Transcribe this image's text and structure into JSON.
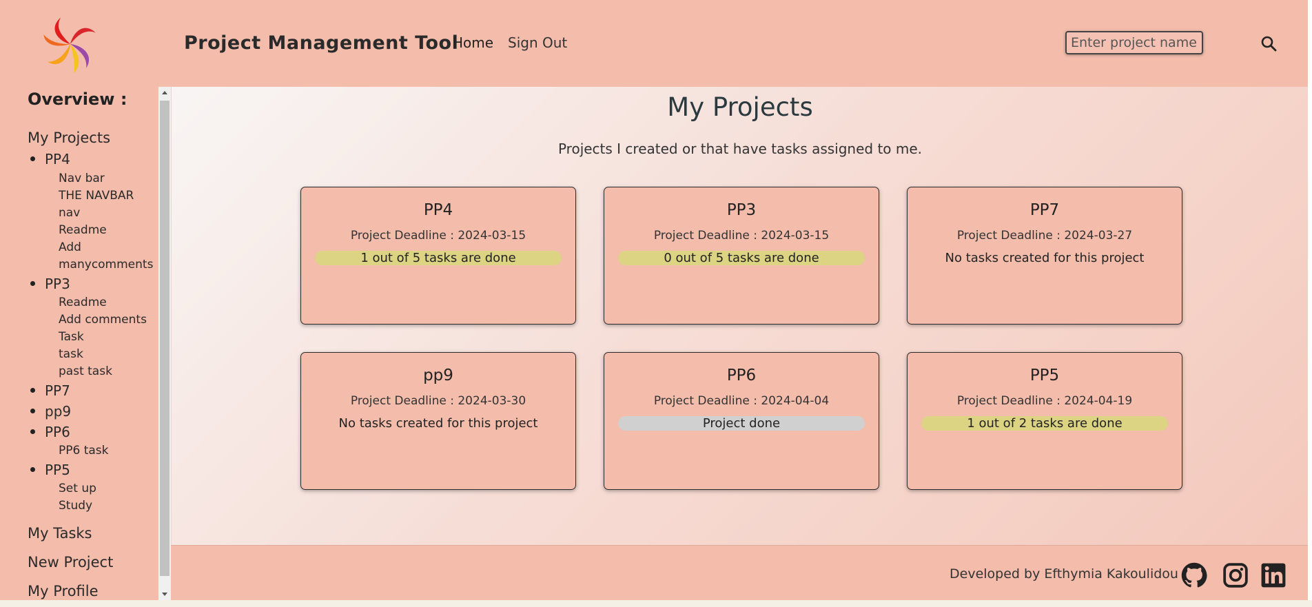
{
  "header": {
    "brand": "Project  Management  Tool",
    "nav": {
      "home": "Home",
      "sign_out": "Sign Out"
    },
    "search": {
      "placeholder": "Enter project name",
      "icon": "search-icon"
    }
  },
  "sidebar": {
    "title": "Overview :",
    "my_projects": "My Projects",
    "projects": [
      {
        "name": "PP4",
        "tasks": [
          "Nav bar",
          "THE NAVBAR",
          "nav",
          "Readme",
          "Add",
          "manycomments"
        ]
      },
      {
        "name": "PP3",
        "tasks": [
          "Readme",
          "Add comments",
          "Task",
          "task",
          "past task"
        ]
      },
      {
        "name": "PP7",
        "tasks": []
      },
      {
        "name": "pp9",
        "tasks": []
      },
      {
        "name": "PP6",
        "tasks": [
          "PP6 task"
        ]
      },
      {
        "name": "PP5",
        "tasks": [
          "Set up",
          "Study"
        ]
      }
    ],
    "my_tasks": "My Tasks",
    "new_project": "New Project",
    "my_profile": "My Profile"
  },
  "main": {
    "title": "My Projects",
    "subtitle": "Projects I created or that have tasks assigned to me.",
    "cards": [
      {
        "name": "PP4",
        "deadline": "Project Deadline : 2024-03-15",
        "status": "1 out of 5 tasks are done",
        "status_type": "progress"
      },
      {
        "name": "PP3",
        "deadline": "Project Deadline : 2024-03-15",
        "status": "0 out of 5 tasks are done",
        "status_type": "progress"
      },
      {
        "name": "PP7",
        "deadline": "Project Deadline : 2024-03-27",
        "status": "No tasks created for this project",
        "status_type": "none"
      },
      {
        "name": "pp9",
        "deadline": "Project Deadline : 2024-03-30",
        "status": "No tasks created for this project",
        "status_type": "none"
      },
      {
        "name": "PP6",
        "deadline": "Project Deadline : 2024-04-04",
        "status": "Project done",
        "status_type": "done"
      },
      {
        "name": "PP5",
        "deadline": "Project Deadline : 2024-04-19",
        "status": "1 out of 2 tasks are done",
        "status_type": "progress"
      }
    ]
  },
  "footer": {
    "text": "Developed by Efthymia Kakoulidou",
    "icons": [
      "github-icon",
      "instagram-icon",
      "linkedin-icon"
    ]
  },
  "colors": {
    "background": "#f3bcab",
    "progress_pill": "#dcd383",
    "done_pill": "#d0d0d0",
    "title_text": "#2b3a3e"
  }
}
